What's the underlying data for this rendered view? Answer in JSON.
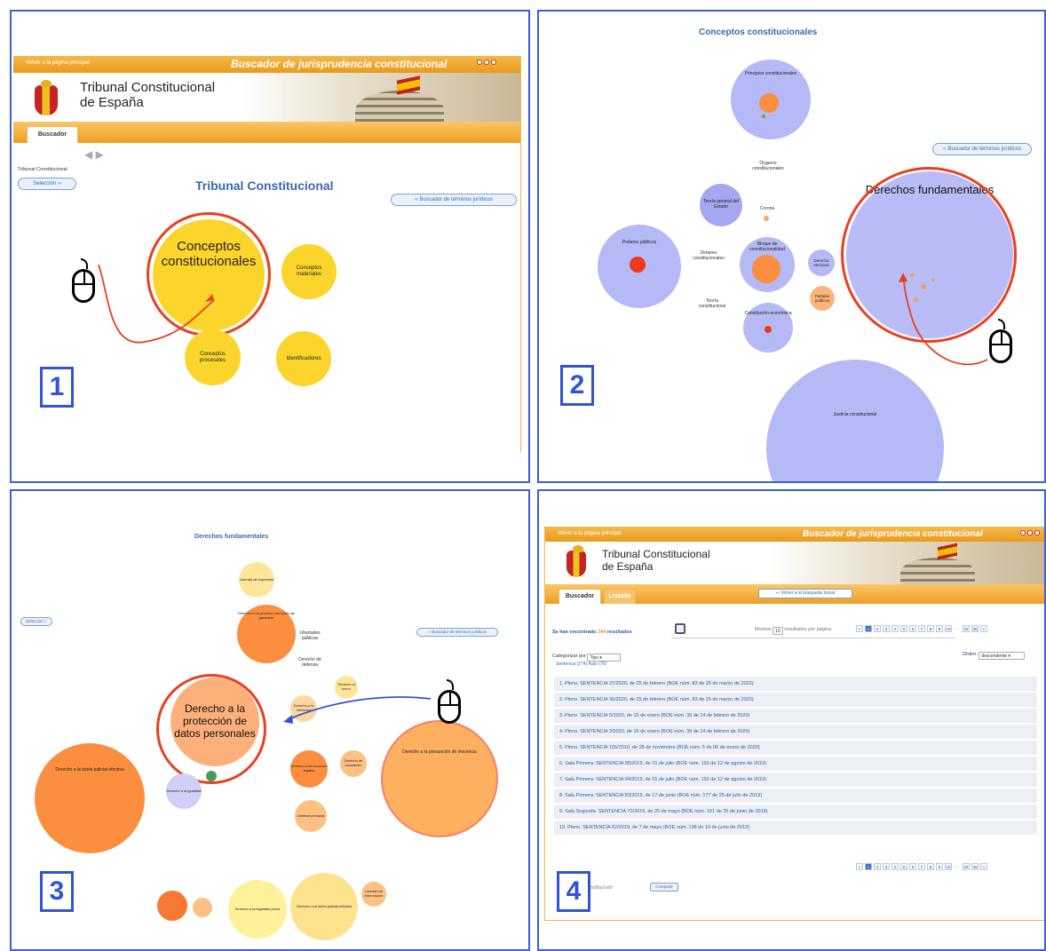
{
  "panels": {
    "p1": {
      "number": "1",
      "back_link": "Volver a la página principal",
      "header_title": "Buscador de jurisprudencia constitucional",
      "org_line1": "Tribunal Constitucional",
      "org_line2": "de España",
      "tab_buscador": "Buscador",
      "breadcrumb": "Tribunal Constitucional",
      "seleccion": "Selección",
      "main_title": "Tribunal Constitucional",
      "terms_button": "Buscador de términos jurídicos",
      "bubbles": {
        "conceptos_constitucionales": "Conceptos constitucionales",
        "conceptos_materiales": "Conceptos materiales",
        "conceptos_procesales": "Conceptos procesales",
        "identificadores": "Identificadores"
      }
    },
    "p2": {
      "number": "2",
      "title": "Conceptos constitucionales",
      "terms_button": "Buscador de términos jurídicos",
      "bubbles": {
        "principios": "Principios constitucionales",
        "organos": "Órganos constitucionales",
        "teoria_general": "Teoría general del Estado",
        "corona": "Corona",
        "poderes_publicos": "Poderes públicos",
        "deberes": "Deberes constitucionales",
        "bloque": "Bloque de constitucionalidad",
        "derecho_electoral": "Derecho electoral",
        "partidos": "Partidos políticos",
        "teoria_constitucional": "Teoría constitucional",
        "constitucion_economica": "Constitución económica",
        "derechos_fundamentales": "Derechos fundamentales",
        "justicia": "Justicia constitucional"
      }
    },
    "p3": {
      "number": "3",
      "title": "Derechos fundamentales",
      "seleccion": "Selección",
      "terms_button": "Buscador de términos jurídicos",
      "highlight": "Derecho a la protección de datos personales",
      "labels": {
        "tutela": "Derecho a la tutela judicial efectiva",
        "presuncion": "Derecho a la presunción de inocencia",
        "proceso": "Derecho a un proceso con todas las garantías",
        "libertad_expresion": "Libertad de expresión",
        "libertades_publicas": "Libertades públicas",
        "defensa": "Derecho de defensa",
        "honor": "Derecho al honor",
        "intimidad": "Derecho a la intimidad",
        "legalidad_penal": "Derecho a la legalidad penal",
        "recurso": "Derecho a los recursos legales",
        "libertad_personal": "Libertad personal",
        "igualdad": "Derecho a la igualdad",
        "asociacion": "Derecho de asociación",
        "libertad_informacion": "Libertad de información"
      }
    },
    "p4": {
      "number": "4",
      "back_link": "Volver a la página principal",
      "header_title": "Buscador de jurisprudencia constitucional",
      "org_line1": "Tribunal Constitucional",
      "org_line2": "de España",
      "tab_buscador": "Buscador",
      "tab_listado": "Listado",
      "volver_busqueda": "Volver a la búsqueda inicial",
      "found_prefix": "Se han encontrado",
      "found_count": "344",
      "found_suffix": "resultados",
      "show_label": "Mostrar",
      "per_page_value": "10",
      "per_page_label": "resultados por página",
      "categorize_label": "Categorizar por",
      "categorize_value": "Tipo",
      "category_counts": "Sentencia (274) Auto (70)",
      "order_label": "Orden:",
      "order_value": "descendente",
      "pages": [
        "«",
        "1",
        "2",
        "3",
        "4",
        "5",
        "6",
        "7",
        "8",
        "9",
        "10",
        "...",
        "34",
        "35",
        "»"
      ],
      "results": [
        "1. Pleno. SENTENCIA 37/2020, de 25 de febrero (BOE núm. 83 de 26 de marzo de 2020)",
        "2. Pleno. SENTENCIA 36/2020, de 25 de febrero (BOE núm. 83 de 26 de marzo de 2020)",
        "3. Pleno. SENTENCIA 5/2020, de 15 de enero (BOE núm. 39 de 14 de febrero de 2020)",
        "4. Pleno. SENTENCIA 3/2020, de 15 de enero (BOE núm. 39 de 14 de febrero de 2020)",
        "5. Pleno. SENTENCIA 155/2019, de 28 de noviembre (BOE núm. 5 de 06 de enero de 2020)",
        "6. Sala Primera. SENTENCIA 95/2019, de 15 de julio (BOE núm. 192 de 12 de agosto de 2019)",
        "7. Sala Primera. SENTENCIA 94/2019, de 15 de julio (BOE núm. 192 de 12 de agosto de 2019)",
        "8. Sala Primera. SENTENCIA 83/2019, de 17 de junio (BOE núm. 177 de 25 de julio de 2019)",
        "9. Sala Segunda. SENTENCIA 72/2019, de 20 de mayo (BOE núm. 151 de 25 de junio de 2019)",
        "10. Pleno. SENTENCIA 62/2019, de 7 de mayo (BOE núm. 138 de 10 de junio de 2019)"
      ],
      "share_id": "ds8bp2a6f",
      "share_button": "Compartir"
    }
  },
  "colors": {
    "panel_border": "#3d5fd8",
    "orange_bar": "#ea9a1c",
    "yellow_bubble": "#fbd52c",
    "purple_bubble": "#b5b9f6",
    "orange_bubble": "#fc8f3f",
    "highlight_ring": "#e8401f",
    "link_blue": "#3a6bab"
  }
}
